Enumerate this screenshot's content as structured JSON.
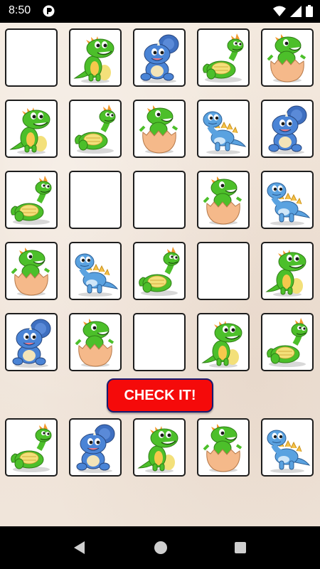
{
  "status_bar": {
    "time": "8:50",
    "icons": [
      "app-notification-icon",
      "wifi-icon",
      "signal-icon",
      "battery-icon"
    ]
  },
  "colors": {
    "check_button": "#f50a0a",
    "check_border": "#1a1a6e",
    "green_dino": "#4cbf2a",
    "blue_dino": "#4a84d6",
    "egg": "#f5b98a"
  },
  "grid": {
    "rows": [
      [
        "empty",
        "green-standing",
        "blue-triceratops",
        "green-lying",
        "green-hatching"
      ],
      [
        "green-standing",
        "green-lying",
        "green-hatching",
        "blue-stegosaurus",
        "blue-triceratops"
      ],
      [
        "green-lying",
        "empty",
        "empty",
        "green-hatching",
        "blue-stegosaurus"
      ],
      [
        "green-hatching",
        "blue-stegosaurus",
        "green-lying",
        "empty",
        "green-standing"
      ],
      [
        "blue-triceratops",
        "green-hatching",
        "empty",
        "green-standing",
        "green-lying"
      ]
    ]
  },
  "check_button": {
    "label": "CHECK IT!"
  },
  "tray": {
    "pieces": [
      "green-lying",
      "blue-triceratops",
      "green-standing",
      "green-hatching",
      "blue-stegosaurus"
    ]
  },
  "nav_bar": {
    "buttons": [
      "back-icon",
      "home-icon",
      "recents-icon"
    ]
  }
}
